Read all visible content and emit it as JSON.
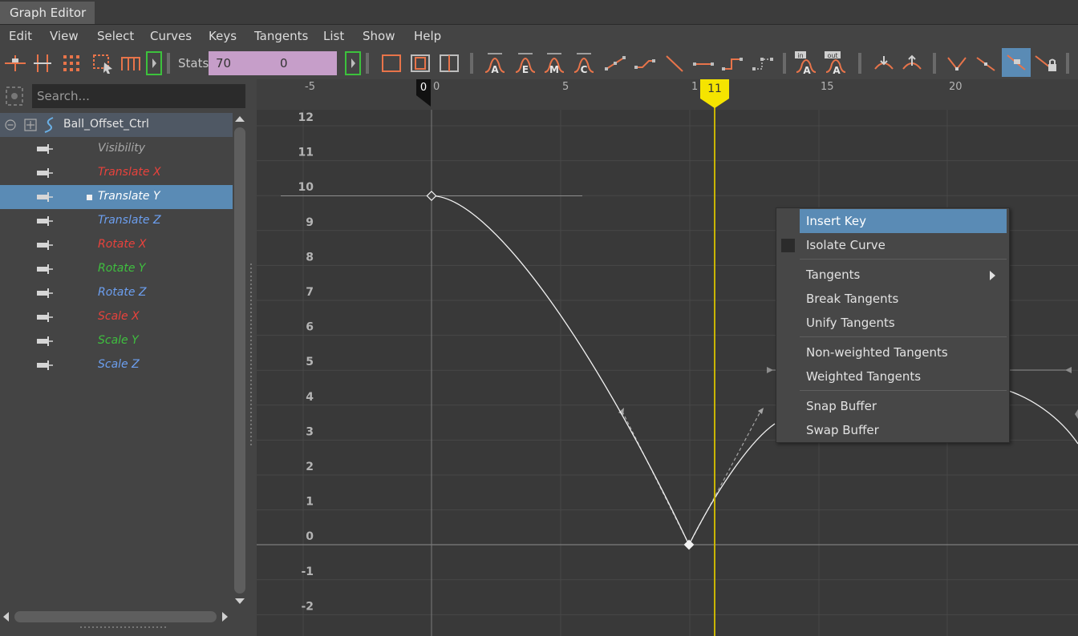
{
  "window": {
    "title": "Graph Editor"
  },
  "menu": [
    "Edit",
    "View",
    "Select",
    "Curves",
    "Keys",
    "Tangents",
    "List",
    "Show",
    "Help"
  ],
  "toolbar": {
    "stats_label": "Stats",
    "stats_value_1": "70",
    "stats_value_2": "0",
    "tangent_icons": [
      "A",
      "E",
      "M",
      "C"
    ],
    "in_label": "in",
    "out_label": "out",
    "in_icon_letter": "A",
    "out_icon_letter": "A"
  },
  "outliner": {
    "search_placeholder": "Search...",
    "root": "Ball_Offset_Ctrl",
    "channels": [
      {
        "label": "Visibility",
        "color": "#a8a8a8"
      },
      {
        "label": "Translate X",
        "color": "#e8423c"
      },
      {
        "label": "Translate Y",
        "color": "#ffffff",
        "selected": true
      },
      {
        "label": "Translate Z",
        "color": "#6c9ff0"
      },
      {
        "label": "Rotate X",
        "color": "#e8423c"
      },
      {
        "label": "Rotate Y",
        "color": "#3fbf3f"
      },
      {
        "label": "Rotate Z",
        "color": "#6c9ff0"
      },
      {
        "label": "Scale X",
        "color": "#e8423c"
      },
      {
        "label": "Scale Y",
        "color": "#3fbf3f"
      },
      {
        "label": "Scale Z",
        "color": "#6c9ff0"
      }
    ]
  },
  "graph": {
    "x_ticks": [
      "-5",
      "0",
      "5",
      "1",
      "15",
      "20"
    ],
    "y_ticks": [
      "12",
      "11",
      "10",
      "9",
      "8",
      "7",
      "6",
      "5",
      "4",
      "3",
      "2",
      "1",
      "0",
      "-1",
      "-2"
    ],
    "start_marker": "0",
    "current_frame": "11",
    "current_frame_color": "#f5e400",
    "curve_keys": [
      {
        "frame": 0,
        "value": 10
      },
      {
        "frame": 10,
        "value": 0
      }
    ]
  },
  "context_menu": {
    "items": [
      {
        "label": "Insert Key",
        "highlight": true
      },
      {
        "label": "Isolate Curve"
      },
      {
        "label": "Tangents",
        "submenu": true
      },
      {
        "label": "Break Tangents"
      },
      {
        "label": "Unify Tangents"
      },
      {
        "label": "Non-weighted Tangents"
      },
      {
        "label": "Weighted Tangents"
      },
      {
        "label": "Snap Buffer"
      },
      {
        "label": "Swap Buffer"
      }
    ]
  }
}
